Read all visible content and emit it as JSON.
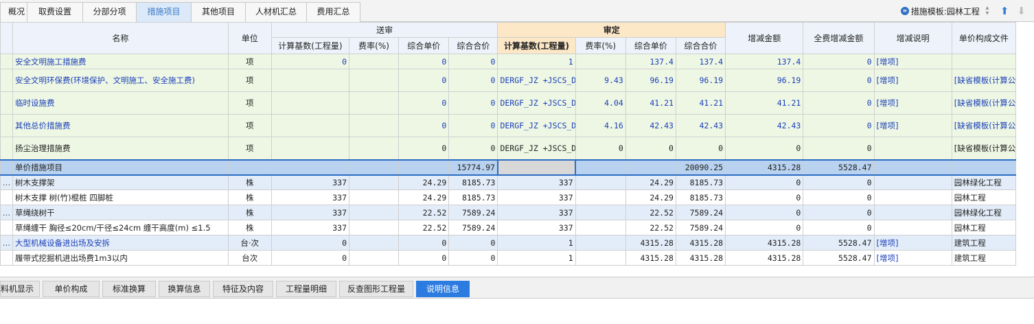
{
  "top_tabs": [
    {
      "label": "概况",
      "active": false
    },
    {
      "label": "取费设置",
      "active": false
    },
    {
      "label": "分部分项",
      "active": false
    },
    {
      "label": "措施项目",
      "active": true
    },
    {
      "label": "其他项目",
      "active": false
    },
    {
      "label": "人材机汇总",
      "active": false
    },
    {
      "label": "费用汇总",
      "active": false
    }
  ],
  "template": {
    "label": "措施模板:园林工程",
    "icon": "template-circle-icon",
    "up_icon": "arrow-up-icon",
    "down_icon": "arrow-down-icon"
  },
  "header": {
    "name": "名称",
    "unit": "单位",
    "submitted_group": "送审",
    "approved_group": "审定",
    "sub_base": "计算基数(工程量)",
    "sub_rate": "费率(%)",
    "sub_unit_price": "综合单价",
    "sub_total": "综合合价",
    "app_base": "计算基数(工程量)",
    "app_rate": "费率(%)",
    "app_unit_price": "综合单价",
    "app_total": "综合合价",
    "change_amount": "增减金额",
    "full_change_amount": "全费增减金额",
    "change_note": "增减说明",
    "unit_price_doc": "单价构成文件"
  },
  "rows": [
    {
      "ind": "",
      "name": "安全文明施工措施费",
      "unit": "项",
      "s_base": "0",
      "s_rate": "",
      "s_price": "0",
      "s_total": "0",
      "a_base": "1",
      "a_rate": "",
      "a_price": "137.4",
      "a_total": "137.4",
      "chg": "137.4",
      "full_chg": "0",
      "note": "[增项]",
      "doc": ""
    },
    {
      "ind": "",
      "name": "安全文明环保费(环境保护、文明施工、安全施工费)",
      "unit": "项",
      "s_base": "",
      "s_rate": "",
      "s_price": "0",
      "s_total": "0",
      "a_base": "DERGF_JZ\n+JSCS_DERGF_JZ",
      "a_rate": "9.43",
      "a_price": "96.19",
      "a_total": "96.19",
      "chg": "96.19",
      "full_chg": "0",
      "note": "[增项]",
      "doc": "[缺省模板(计算公式组价)]"
    },
    {
      "ind": "",
      "name": "临时设施费",
      "unit": "项",
      "s_base": "",
      "s_rate": "",
      "s_price": "0",
      "s_total": "0",
      "a_base": "DERGF_JZ\n+JSCS_DERGF_JZ",
      "a_rate": "4.04",
      "a_price": "41.21",
      "a_total": "41.21",
      "chg": "41.21",
      "full_chg": "0",
      "note": "[增项]",
      "doc": "[缺省模板(计算公式组价)]"
    },
    {
      "ind": "",
      "name": "其他总价措施费",
      "unit": "项",
      "s_base": "",
      "s_rate": "",
      "s_price": "0",
      "s_total": "0",
      "a_base": "DERGF_JZ\n+JSCS_DERGF_JZ",
      "a_rate": "4.16",
      "a_price": "42.43",
      "a_total": "42.43",
      "chg": "42.43",
      "full_chg": "0",
      "note": "[增项]",
      "doc": "[缺省模板(计算公式组价)]"
    },
    {
      "ind": "",
      "name": "扬尘治理措施费",
      "unit": "项",
      "s_base": "",
      "s_rate": "",
      "s_price": "0",
      "s_total": "0",
      "a_base": "DERGF_JZ\n+JSCS_DERGF_JZ",
      "a_rate": "0",
      "a_price": "0",
      "a_total": "0",
      "chg": "0",
      "full_chg": "0",
      "note": "",
      "doc": "[缺省模板(计算公式组价)]"
    },
    {
      "ind": "",
      "name": "单价措施项目",
      "unit": "",
      "s_base": "",
      "s_rate": "",
      "s_price": "",
      "s_total": "15774.97",
      "a_base": "",
      "a_rate": "",
      "a_price": "",
      "a_total": "20090.25",
      "chg": "4315.28",
      "full_chg": "5528.47",
      "note": "",
      "doc": ""
    },
    {
      "ind": "…",
      "name": "树木支撑架",
      "unit": "株",
      "s_base": "337",
      "s_rate": "",
      "s_price": "24.29",
      "s_total": "8185.73",
      "a_base": "337",
      "a_rate": "",
      "a_price": "24.29",
      "a_total": "8185.73",
      "chg": "0",
      "full_chg": "0",
      "note": "",
      "doc": "园林绿化工程"
    },
    {
      "ind": "",
      "name": "树木支撑 树(竹)棍桩 四脚桩",
      "unit": "株",
      "s_base": "337",
      "s_rate": "",
      "s_price": "24.29",
      "s_total": "8185.73",
      "a_base": "337",
      "a_rate": "",
      "a_price": "24.29",
      "a_total": "8185.73",
      "chg": "0",
      "full_chg": "0",
      "note": "",
      "doc": "园林工程"
    },
    {
      "ind": "…",
      "name": "草绳绕树干",
      "unit": "株",
      "s_base": "337",
      "s_rate": "",
      "s_price": "22.52",
      "s_total": "7589.24",
      "a_base": "337",
      "a_rate": "",
      "a_price": "22.52",
      "a_total": "7589.24",
      "chg": "0",
      "full_chg": "0",
      "note": "",
      "doc": "园林绿化工程"
    },
    {
      "ind": "",
      "name": "草绳缠干 胸径≤20cm/干径≤24cm 缠干高度(m) ≤1.5",
      "unit": "株",
      "s_base": "337",
      "s_rate": "",
      "s_price": "22.52",
      "s_total": "7589.24",
      "a_base": "337",
      "a_rate": "",
      "a_price": "22.52",
      "a_total": "7589.24",
      "chg": "0",
      "full_chg": "0",
      "note": "",
      "doc": "园林工程"
    },
    {
      "ind": "…",
      "name": "大型机械设备进出场及安拆",
      "unit": "台·次",
      "s_base": "0",
      "s_rate": "",
      "s_price": "0",
      "s_total": "0",
      "a_base": "1",
      "a_rate": "",
      "a_price": "4315.28",
      "a_total": "4315.28",
      "chg": "4315.28",
      "full_chg": "5528.47",
      "note": "[增项]",
      "doc": "建筑工程"
    },
    {
      "ind": "",
      "name": "履带式挖掘机进出场费1m3以内",
      "unit": "台次",
      "s_base": "0",
      "s_rate": "",
      "s_price": "0",
      "s_total": "0",
      "a_base": "1",
      "a_rate": "",
      "a_price": "4315.28",
      "a_total": "4315.28",
      "chg": "4315.28",
      "full_chg": "5528.47",
      "note": "[增项]",
      "doc": "建筑工程"
    }
  ],
  "bottom_tabs": [
    {
      "label": "料机显示",
      "active": false
    },
    {
      "label": "单价构成",
      "active": false
    },
    {
      "label": "标准换算",
      "active": false
    },
    {
      "label": "换算信息",
      "active": false
    },
    {
      "label": "特征及内容",
      "active": false
    },
    {
      "label": "工程量明细",
      "active": false
    },
    {
      "label": "反查图形工程量",
      "active": false
    },
    {
      "label": "说明信息",
      "active": true
    }
  ]
}
